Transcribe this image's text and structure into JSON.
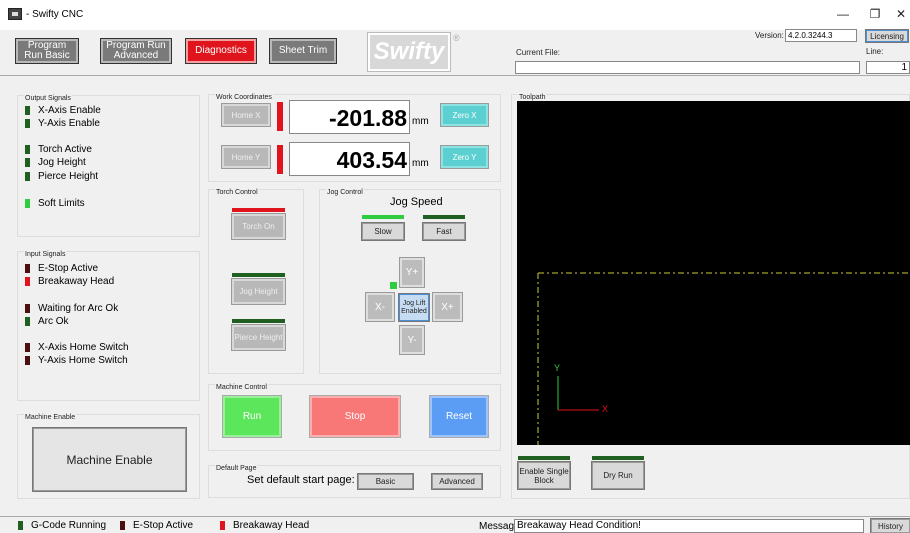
{
  "window": {
    "title": "- Swifty CNC",
    "min_label": "—",
    "restore_label": "❐",
    "close_label": "✕"
  },
  "toolbar": {
    "program_run_basic": "Program Run Basic",
    "program_run_advanced": "Program Run Advanced",
    "diagnostics": "Diagnostics",
    "sheet_trim": "Sheet Trim",
    "logo": "Swifty",
    "reg_mark": "®",
    "version_label": "Version:",
    "version_value": "4.2.0.3244.3",
    "licensing": "Licensing",
    "current_file_label": "Current File:",
    "current_file_value": "",
    "line_label": "Line:",
    "line_value": "1"
  },
  "output_signals": {
    "title": "Output Signals",
    "items": [
      "X-Axis Enable",
      "Y-Axis Enable",
      "Torch Active",
      "Jog Height",
      "Pierce Height",
      "Soft Limits"
    ]
  },
  "input_signals": {
    "title": "Input Signals",
    "items": [
      "E-Stop Active",
      "Breakaway Head",
      "Waiting for Arc Ok",
      "Arc Ok",
      "X-Axis Home Switch",
      "Y-Axis Home Switch"
    ]
  },
  "machine_enable": {
    "title": "Machine Enable",
    "button": "Machine Enable"
  },
  "work_coordinates": {
    "title": "Work Coordinates",
    "home_x": "Home X",
    "home_y": "Home Y",
    "x_value": "-201.88",
    "y_value": "403.54",
    "unit": "mm",
    "zero_x": "Zero X",
    "zero_y": "Zero Y"
  },
  "torch_control": {
    "title": "Torch Control",
    "torch_on": "Torch On",
    "jog_height": "Jog Height",
    "pierce_height": "Pierce Height"
  },
  "jog_control": {
    "title": "Jog Control",
    "speed_label": "Jog Speed",
    "slow": "Slow",
    "fast": "Fast",
    "y_plus": "Y+",
    "y_minus": "Y-",
    "x_minus": "X-",
    "x_plus": "X+",
    "jog_lift": "Jog Lift Enabled"
  },
  "machine_control": {
    "title": "Machine Control",
    "run": "Run",
    "stop": "Stop",
    "reset": "Reset"
  },
  "default_page": {
    "title": "Default Page",
    "label": "Set default start page:",
    "basic": "Basic",
    "advanced": "Advanced"
  },
  "toolpath": {
    "title": "Toolpath",
    "axis_y": "Y",
    "axis_x": "X"
  },
  "run_options": {
    "single_block": "Enable Single Block",
    "dry_run": "Dry Run"
  },
  "statusbar": {
    "gcode_running": "G-Code Running",
    "estop_active": "E-Stop Active",
    "breakaway_head": "Breakaway Head",
    "message_label": "Message:",
    "message_value": "Breakaway Head Condition!",
    "history": "History"
  },
  "colors": {
    "accent_red": "#e0141c",
    "led_green": "#2ecc40",
    "led_dark": "#1f5f1f",
    "led_off": "#4a1010",
    "run_green": "#5ce65c",
    "stop_red": "#f87878",
    "reset_blue": "#5b9cf5",
    "zero_cyan": "#5ccfd0",
    "toolpath_bg": "#000000",
    "toolpath_line": "#cccc33"
  }
}
